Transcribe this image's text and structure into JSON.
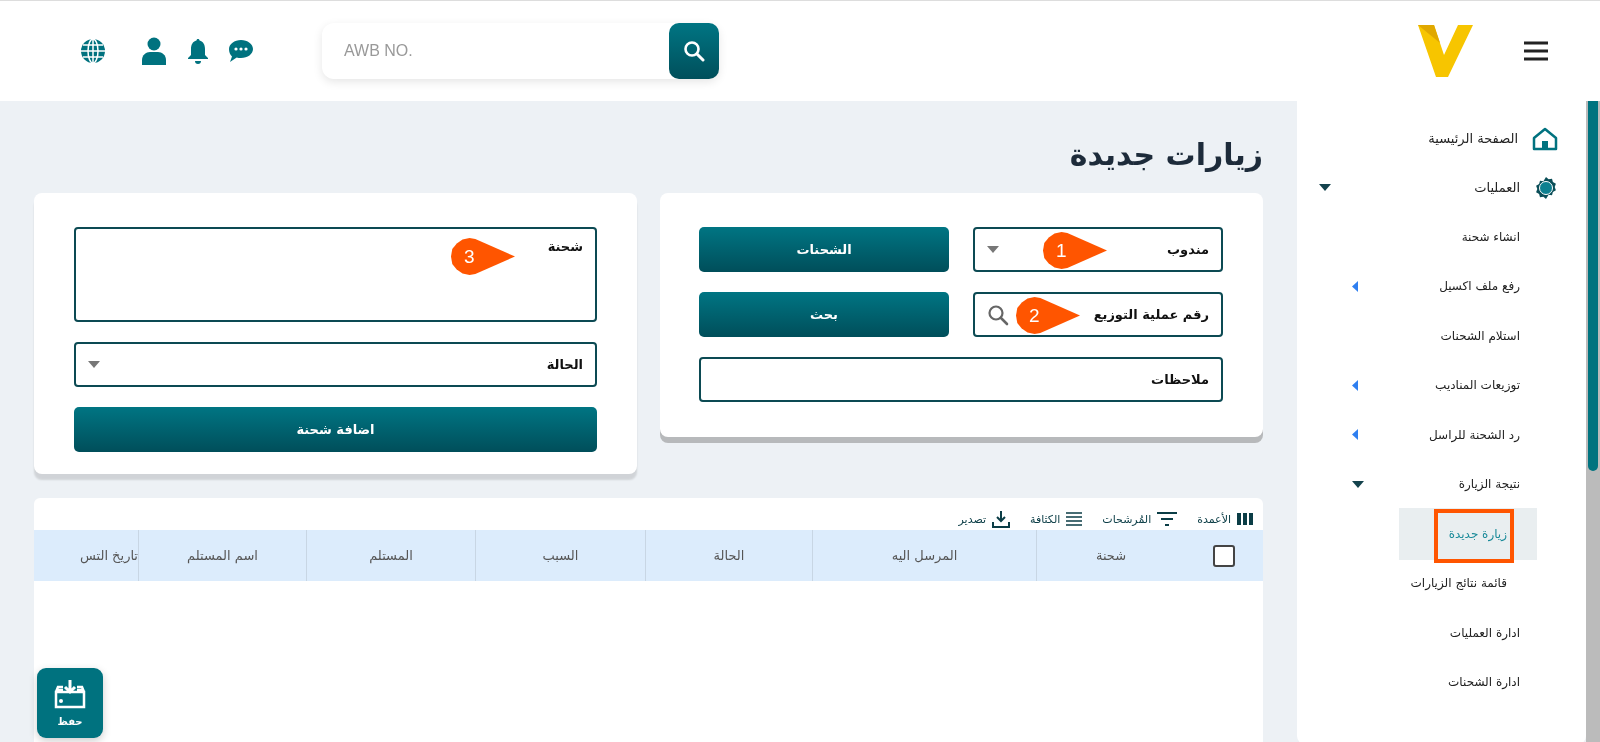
{
  "header": {
    "search": {
      "placeholder": "AWB NO."
    }
  },
  "page": {
    "title": "زيارات جديدة"
  },
  "visit_form": {
    "agent": {
      "value": "مندوب",
      "callout": "1"
    },
    "shipments_button": "الشحنات",
    "distribution": {
      "value": "رقم عملية التوزيع",
      "callout": "2"
    },
    "search_button": "بحث",
    "notes": {
      "value": "ملاحظات"
    }
  },
  "shipment_form": {
    "shipment": {
      "value": "شحنة",
      "callout": "3"
    },
    "status": {
      "value": "الحالة"
    },
    "add_button": "اضافة شحنة"
  },
  "table": {
    "toolbar": [
      "الأعمدة",
      "المُرشحات",
      "الكثافة",
      "تصدير"
    ],
    "select_all": {
      "checked": false
    },
    "columns": [
      "شحنة",
      "المرسل اليه",
      "الحالة",
      "السبب",
      "المستلم",
      "اسم المستلم",
      "تاريخ التس"
    ]
  },
  "save_button": "حفظ",
  "sidebar": {
    "items": [
      {
        "label": "الصفحة الرئيسية",
        "kind": "link",
        "selected": false
      },
      {
        "label": "العمليات",
        "kind": "group",
        "expanded": true,
        "selected": false,
        "children": [
          {
            "label": "انشاء شحنة",
            "kind": "link",
            "selected": false
          },
          {
            "label": "رفع ملف اكسيل",
            "kind": "group",
            "expanded": false,
            "selected": false
          },
          {
            "label": "استلام الشحنات",
            "kind": "link",
            "selected": false
          },
          {
            "label": "توزيعات المناديب",
            "kind": "group",
            "expanded": false,
            "selected": false
          },
          {
            "label": "رد الشحنة للراسل",
            "kind": "group",
            "expanded": false,
            "selected": false
          },
          {
            "label": "نتيجة الزيارة",
            "kind": "group",
            "expanded": true,
            "selected": false,
            "children": [
              {
                "label": "زيارة جديدة",
                "selected": true,
                "highlighted": true
              },
              {
                "label": "قائمة نتائج الزيارات",
                "selected": false,
                "highlighted": false
              }
            ]
          },
          {
            "label": "ادارة العمليات",
            "kind": "link",
            "selected": false
          },
          {
            "label": "ادارة الشحنات",
            "kind": "link",
            "selected": false
          }
        ]
      }
    ]
  }
}
